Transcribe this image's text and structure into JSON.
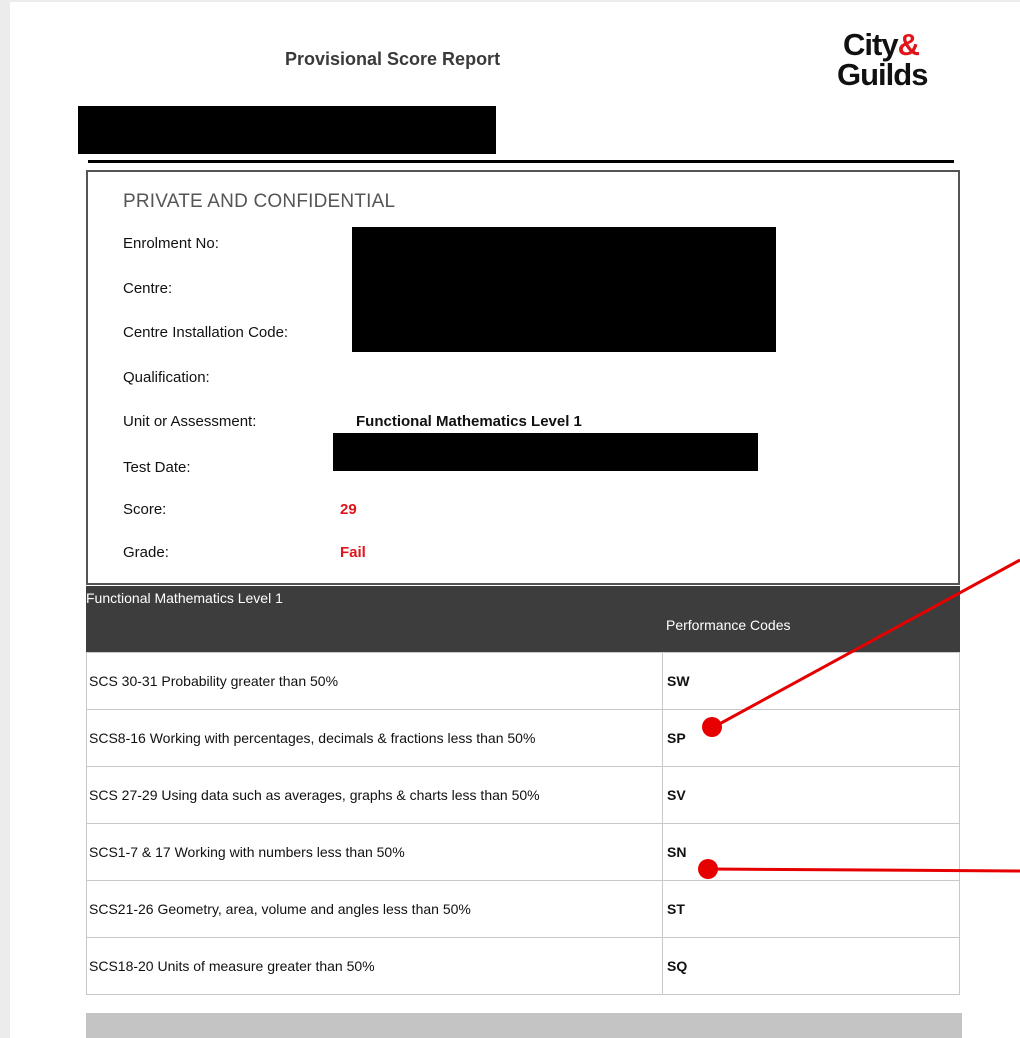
{
  "report": {
    "title": "Provisional Score Report",
    "logo": {
      "line1": "City",
      "amp": "&",
      "line2": "Guilds"
    },
    "confidential": "PRIVATE AND CONFIDENTIAL",
    "fields": {
      "enrolment_label": "Enrolment No:",
      "centre_label": "Centre:",
      "installation_label": "Centre Installation Code:",
      "qualification_label": "Qualification:",
      "unit_label": "Unit or Assessment:",
      "unit_value": "Functional Mathematics Level 1",
      "test_date_label": "Test Date:",
      "score_label": "Score:",
      "score_value": "29",
      "grade_label": "Grade:",
      "grade_value": "Fail"
    },
    "table": {
      "title": "Functional Mathematics Level 1",
      "code_header": "Performance Codes",
      "rows": [
        {
          "desc": "SCS 30-31 Probability  greater than 50%",
          "code": "SW"
        },
        {
          "desc": "SCS8-16 Working with percentages, decimals & fractions  less than 50%",
          "code": "SP"
        },
        {
          "desc": "SCS 27-29 Using data such as averages, graphs & charts  less than 50%",
          "code": "SV"
        },
        {
          "desc": "SCS1-7 & 17 Working with numbers  less than 50%",
          "code": "SN"
        },
        {
          "desc": "SCS21-26 Geometry, area, volume and angles  less than 50%",
          "code": "ST"
        },
        {
          "desc": "SCS18-20 Units of measure  greater than 50%",
          "code": "SQ"
        }
      ]
    },
    "colors": {
      "accent_red": "#e0141b",
      "annotation_red": "#e60000",
      "header_dark": "#3d3d3d"
    }
  }
}
